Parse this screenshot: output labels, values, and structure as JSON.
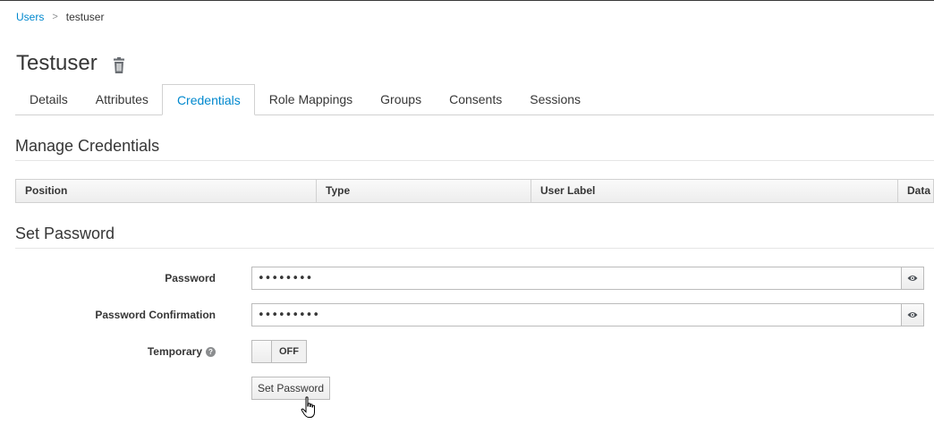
{
  "breadcrumb": {
    "root": "Users",
    "separator": ">",
    "current": "testuser"
  },
  "page": {
    "title": "Testuser",
    "delete_icon": "trash-icon"
  },
  "tabs": [
    {
      "label": "Details",
      "active": false
    },
    {
      "label": "Attributes",
      "active": false
    },
    {
      "label": "Credentials",
      "active": true
    },
    {
      "label": "Role Mappings",
      "active": false
    },
    {
      "label": "Groups",
      "active": false
    },
    {
      "label": "Consents",
      "active": false
    },
    {
      "label": "Sessions",
      "active": false
    }
  ],
  "manage_credentials": {
    "title": "Manage Credentials",
    "columns": [
      "Position",
      "Type",
      "User Label",
      "Data"
    ]
  },
  "set_password": {
    "title": "Set Password",
    "password_label": "Password",
    "password_value": "••••••••",
    "confirm_label": "Password Confirmation",
    "confirm_value": "•••••••••",
    "temporary_label": "Temporary",
    "temporary_state": "OFF",
    "submit_label": "Set Password"
  },
  "colors": {
    "accent": "#0088ce",
    "text": "#363636",
    "border": "#d1d1d1"
  }
}
